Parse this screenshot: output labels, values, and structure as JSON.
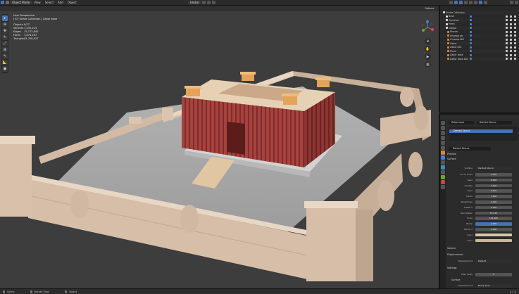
{
  "topbar": {
    "menu": [
      "Object Mode",
      "View",
      "Select",
      "Add",
      "Object"
    ],
    "transform": "Global",
    "options": "Options"
  },
  "viewport": {
    "overlay": [
      "User Perspective",
      "(37) Scene Collection | Zabor base",
      "Objects",
      "Vertices",
      "Edges",
      "Faces",
      "Triangles"
    ],
    "stats": [
      "0/27",
      "7,252,224",
      "15,172,842",
      "7,874,267",
      "15,708,027"
    ]
  },
  "outliner": {
    "title": "Scene Collection",
    "items": [
      "Base",
      "Cameras",
      "Mesh",
      "Сфера",
      "Stones",
      "Ограда цв",
      "Ограда.001",
      "Zabor",
      "Zabor.001",
      "Plane",
      "Zabor base",
      "Zabor base.001"
    ]
  },
  "properties": {
    "object": "Zabor base",
    "material_tab": "Dented Stucco",
    "slot": "Dented Stucco",
    "material": "Dented Stucco",
    "sections": {
      "preview": "Preview",
      "surface": "Surface",
      "volume": "Volume",
      "displacement": "Displacement",
      "settings": "Settings"
    },
    "surface_shader": "Dented Stucco",
    "surface_label": "Surface",
    "fields": [
      {
        "label": "Curve Scale",
        "value": "1.000"
      },
      {
        "label": "Seed",
        "value": "0.400"
      },
      {
        "label": "Density",
        "value": "1.000"
      },
      {
        "label": "Seed",
        "value": "0.400"
      },
      {
        "label": "Dents",
        "value": "7.400"
      },
      {
        "label": "Roughness",
        "value": "1.000"
      },
      {
        "label": "Detail 2",
        "value": "2.300"
      },
      {
        "label": "Dent Detail",
        "value": "19.120"
      },
      {
        "label": "Scale",
        "value": "101.660"
      },
      {
        "label": "Bump",
        "value": "1.000"
      },
      {
        "label": "Bump 2",
        "value": "1.000"
      },
      {
        "label": "Color",
        "value": ""
      },
      {
        "label": "Color",
        "value": ""
      }
    ],
    "displacement_label": "Displacement",
    "displacement_value": "Default",
    "pass_index_label": "Pass Index",
    "pass_index_value": "0",
    "subsurface": "Surface",
    "disp_method_label": "Displacement",
    "disp_method_value": "Bump Only"
  },
  "status": {
    "left": "Select",
    "mid1": "Rotate View",
    "mid2": "Object",
    "version": "4.2.0"
  },
  "colors": {
    "accent": "#4772b3",
    "fortress": "#a8423e",
    "wall": "#d9c2ad",
    "ground": "#a5a5a5",
    "wood": "#e0a050"
  }
}
